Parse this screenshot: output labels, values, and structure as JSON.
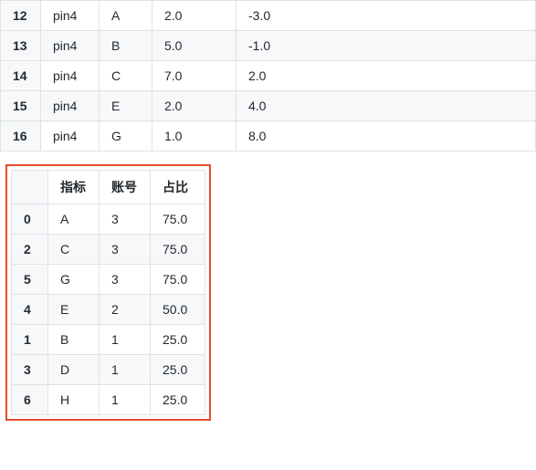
{
  "table1": {
    "rows": [
      {
        "idx": "12",
        "c0": "pin4",
        "c1": "A",
        "c2": "2.0",
        "c3": "-3.0"
      },
      {
        "idx": "13",
        "c0": "pin4",
        "c1": "B",
        "c2": "5.0",
        "c3": "-1.0"
      },
      {
        "idx": "14",
        "c0": "pin4",
        "c1": "C",
        "c2": "7.0",
        "c3": "2.0"
      },
      {
        "idx": "15",
        "c0": "pin4",
        "c1": "E",
        "c2": "2.0",
        "c3": "4.0"
      },
      {
        "idx": "16",
        "c0": "pin4",
        "c1": "G",
        "c2": "1.0",
        "c3": "8.0"
      }
    ]
  },
  "table2": {
    "headers": {
      "h0": "",
      "h1": "指标",
      "h2": "账号",
      "h3": "占比"
    },
    "rows": [
      {
        "idx": "0",
        "c0": "A",
        "c1": "3",
        "c2": "75.0"
      },
      {
        "idx": "2",
        "c0": "C",
        "c1": "3",
        "c2": "75.0"
      },
      {
        "idx": "5",
        "c0": "G",
        "c1": "3",
        "c2": "75.0"
      },
      {
        "idx": "4",
        "c0": "E",
        "c1": "2",
        "c2": "50.0"
      },
      {
        "idx": "1",
        "c0": "B",
        "c1": "1",
        "c2": "25.0"
      },
      {
        "idx": "3",
        "c0": "D",
        "c1": "1",
        "c2": "25.0"
      },
      {
        "idx": "6",
        "c0": "H",
        "c1": "1",
        "c2": "25.0"
      }
    ]
  },
  "colors": {
    "highlight_border": "#e84a2b"
  }
}
